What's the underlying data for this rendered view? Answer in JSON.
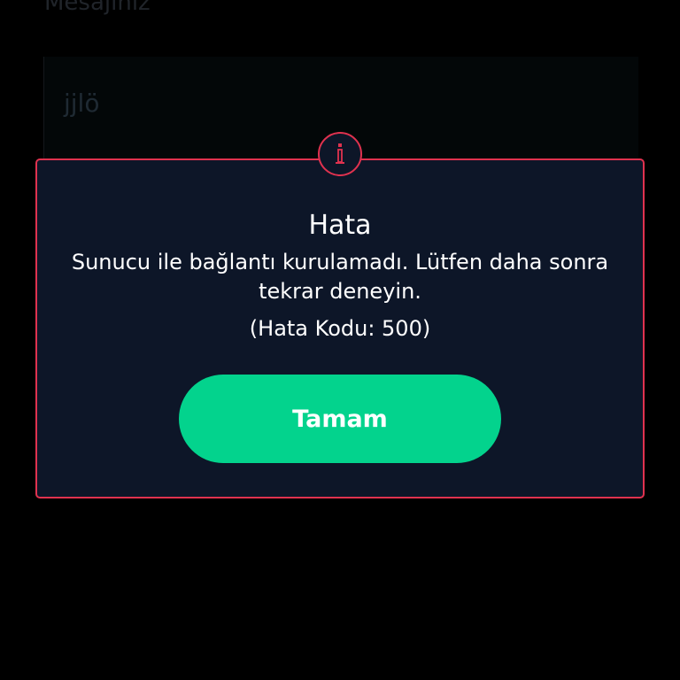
{
  "background": {
    "field_label": "Mesajınız",
    "field_value": "jjlö"
  },
  "dialog": {
    "icon": "info-icon",
    "title": "Hata",
    "message": "Sunucu ile bağlantı kurulamadı. Lütfen daha sonra tekrar deneyin.",
    "code": "(Hata Kodu: 500)",
    "ok_label": "Tamam"
  },
  "colors": {
    "page_background": "#000000",
    "dialog_background": "#0d1628",
    "dialog_border": "#e0324f",
    "button_background": "#03d38d",
    "button_text": "#ffffff"
  }
}
